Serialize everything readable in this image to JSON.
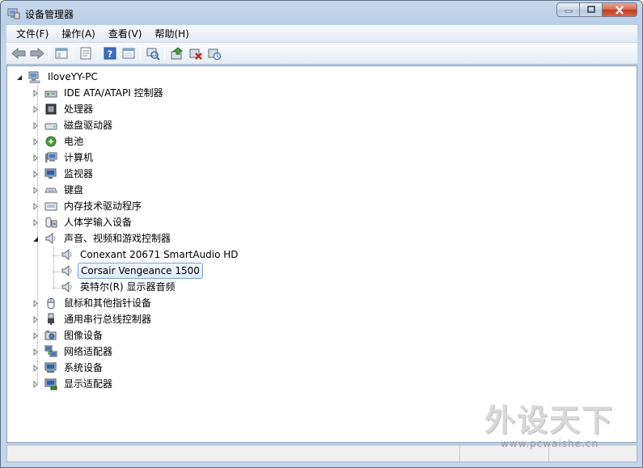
{
  "window": {
    "title": "设备管理器"
  },
  "menu": [
    "文件(F)",
    "操作(A)",
    "查看(V)",
    "帮助(H)"
  ],
  "toolbar_icons": [
    "back-icon",
    "forward-icon",
    "show-hide-tree-icon",
    "properties-icon",
    "help-icon",
    "view-icon",
    "scan-hardware-icon",
    "update-driver-icon",
    "uninstall-icon",
    "disable-icon"
  ],
  "tree": {
    "root": "IloveYY-PC",
    "categories": [
      {
        "label": "IDE ATA/ATAPI 控制器",
        "icon": "ide-controller-icon",
        "expanded": false
      },
      {
        "label": "处理器",
        "icon": "processor-icon",
        "expanded": false
      },
      {
        "label": "磁盘驱动器",
        "icon": "disk-drive-icon",
        "expanded": false
      },
      {
        "label": "电池",
        "icon": "battery-icon",
        "expanded": false
      },
      {
        "label": "计算机",
        "icon": "computer-icon",
        "expanded": false
      },
      {
        "label": "监视器",
        "icon": "monitor-icon",
        "expanded": false
      },
      {
        "label": "键盘",
        "icon": "keyboard-icon",
        "expanded": false
      },
      {
        "label": "内存技术驱动程序",
        "icon": "memory-icon",
        "expanded": false
      },
      {
        "label": "人体学输入设备",
        "icon": "hid-icon",
        "expanded": false
      },
      {
        "label": "声音、视频和游戏控制器",
        "icon": "speaker-icon",
        "expanded": true,
        "children": [
          {
            "label": "Conexant 20671 SmartAudio HD",
            "selected": false
          },
          {
            "label": "Corsair Vengeance 1500",
            "selected": true
          },
          {
            "label": "英特尔(R) 显示器音频",
            "selected": false
          }
        ]
      },
      {
        "label": "鼠标和其他指针设备",
        "icon": "mouse-icon",
        "expanded": false
      },
      {
        "label": "通用串行总线控制器",
        "icon": "usb-icon",
        "expanded": false
      },
      {
        "label": "图像设备",
        "icon": "camera-icon",
        "expanded": false
      },
      {
        "label": "网络适配器",
        "icon": "network-icon",
        "expanded": false
      },
      {
        "label": "系统设备",
        "icon": "system-icon",
        "expanded": false
      },
      {
        "label": "显示适配器",
        "icon": "display-adapter-icon",
        "expanded": false
      }
    ]
  },
  "watermark": {
    "big": "外设天下",
    "small": "www.pcwaishe.cn"
  }
}
